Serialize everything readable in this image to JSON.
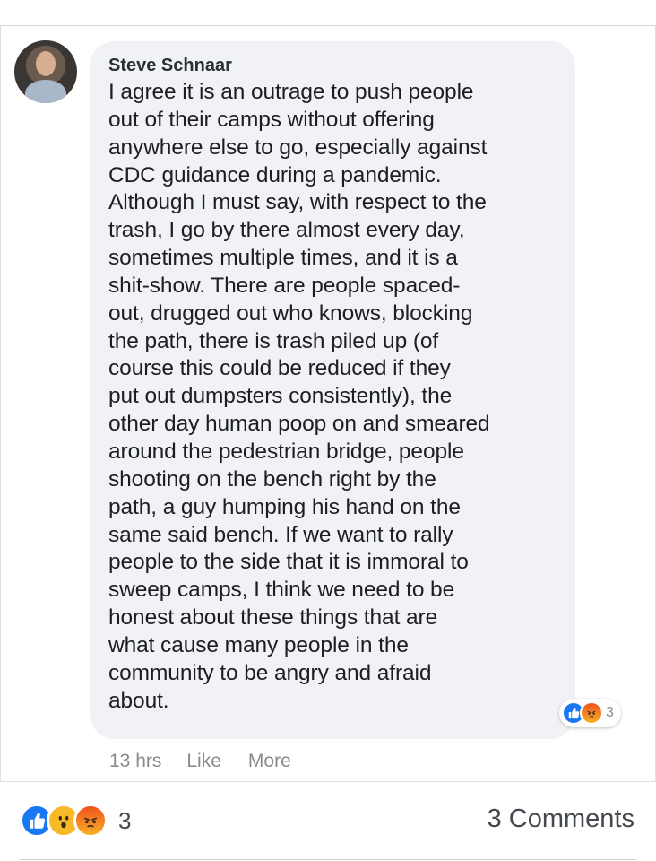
{
  "comment": {
    "author": "Steve Schnaar",
    "text": "I agree it is an outrage to push people\nout of their camps without offering\nanywhere else to go, especially against\nCDC guidance during a pandemic.\nAlthough I must say, with respect to the\ntrash, I go by there almost every day,\nsometimes multiple times, and it is a\nshit-show. There are people spaced-\nout, drugged out who knows, blocking\nthe path, there is trash piled up (of\ncourse this could be reduced if they\nput out dumpsters consistently), the\nother day human poop on and smeared\naround the pedestrian bridge, people\nshooting on the bench right by the\npath, a guy humping his hand on the\nsame said bench. If we want to rally\npeople to the side that it is immoral to\nsweep camps, I think we need to be\nhonest about these things that are\nwhat cause many people in the\ncommunity to be angry and afraid\nabout.",
    "reaction_count": "3",
    "reactions": [
      "like-icon",
      "angry-icon"
    ],
    "time": "13 hrs",
    "like_label": "Like",
    "more_label": "More"
  },
  "post_footer": {
    "reactions": [
      "like-icon",
      "wow-icon",
      "angry-icon"
    ],
    "reaction_count": "3",
    "comments_label": "3 Comments"
  },
  "colors": {
    "bubble_bg": "#f0f2f5",
    "like_blue": "#1877f2",
    "meta_gray": "#888b90"
  }
}
